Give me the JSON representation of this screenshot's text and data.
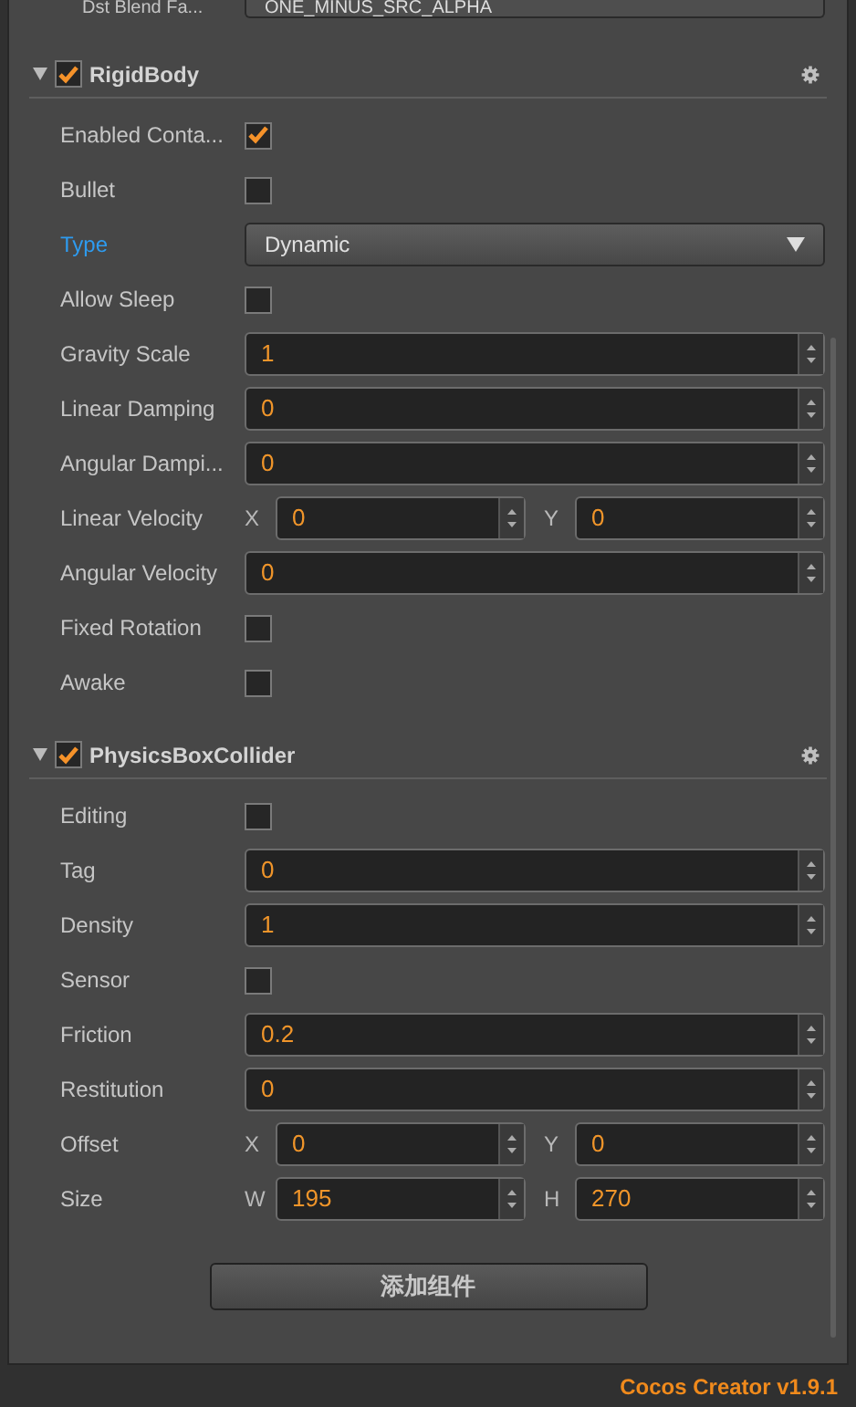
{
  "top_row": {
    "label": "Dst Blend Fa...",
    "value": "ONE_MINUS_SRC_ALPHA"
  },
  "sections": [
    {
      "title": "RigidBody",
      "expanded": true,
      "enabled": true,
      "rows": [
        {
          "kind": "checkbox",
          "label": "Enabled Conta...",
          "highlight": false,
          "checked": true
        },
        {
          "kind": "checkbox",
          "label": "Bullet",
          "highlight": false,
          "checked": false
        },
        {
          "kind": "select",
          "label": "Type",
          "highlight": true,
          "value": "Dynamic"
        },
        {
          "kind": "checkbox",
          "label": "Allow Sleep",
          "highlight": false,
          "checked": false
        },
        {
          "kind": "number",
          "label": "Gravity Scale",
          "highlight": false,
          "value": "1"
        },
        {
          "kind": "number",
          "label": "Linear Damping",
          "highlight": false,
          "value": "0"
        },
        {
          "kind": "number",
          "label": "Angular Dampi...",
          "highlight": false,
          "value": "0"
        },
        {
          "kind": "pair",
          "label": "Linear Velocity",
          "highlight": false,
          "a_label": "X",
          "a_value": "0",
          "b_label": "Y",
          "b_value": "0"
        },
        {
          "kind": "number",
          "label": "Angular Velocity",
          "highlight": false,
          "value": "0"
        },
        {
          "kind": "checkbox",
          "label": "Fixed Rotation",
          "highlight": false,
          "checked": false
        },
        {
          "kind": "checkbox",
          "label": "Awake",
          "highlight": false,
          "checked": false
        }
      ]
    },
    {
      "title": "PhysicsBoxCollider",
      "expanded": true,
      "enabled": true,
      "rows": [
        {
          "kind": "checkbox",
          "label": "Editing",
          "highlight": false,
          "checked": false
        },
        {
          "kind": "number",
          "label": "Tag",
          "highlight": false,
          "value": "0"
        },
        {
          "kind": "number",
          "label": "Density",
          "highlight": false,
          "value": "1"
        },
        {
          "kind": "checkbox",
          "label": "Sensor",
          "highlight": false,
          "checked": false
        },
        {
          "kind": "number",
          "label": "Friction",
          "highlight": false,
          "value": "0.2"
        },
        {
          "kind": "number",
          "label": "Restitution",
          "highlight": false,
          "value": "0"
        },
        {
          "kind": "pair",
          "label": "Offset",
          "highlight": false,
          "a_label": "X",
          "a_value": "0",
          "b_label": "Y",
          "b_value": "0"
        },
        {
          "kind": "pair",
          "label": "Size",
          "highlight": false,
          "a_label": "W",
          "a_value": "195",
          "b_label": "H",
          "b_value": "270"
        }
      ]
    }
  ],
  "add_button": "添加组件",
  "footer": "Cocos Creator v1.9.1"
}
